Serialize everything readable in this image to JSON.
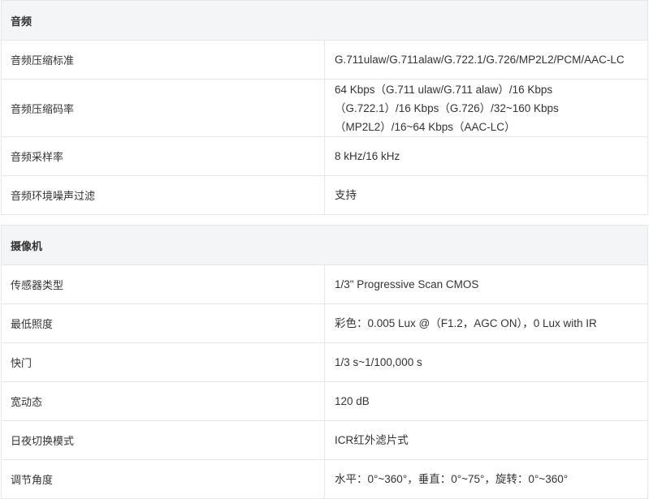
{
  "audio": {
    "title": "音频",
    "rows": [
      {
        "label": "音频压缩标准",
        "value": "G.711ulaw/G.711alaw/G.722.1/G.726/MP2L2/PCM/AAC-LC"
      },
      {
        "label": "音频压缩码率",
        "value": "64 Kbps（G.711 ulaw/G.711 alaw）/16 Kbps（G.722.1）/16 Kbps（G.726）/32~160 Kbps（MP2L2）/16~64 Kbps（AAC-LC）"
      },
      {
        "label": "音频采样率",
        "value": "8 kHz/16 kHz"
      },
      {
        "label": "音频环境噪声过滤",
        "value": "支持"
      }
    ]
  },
  "camera": {
    "title": "摄像机",
    "rows": [
      {
        "label": "传感器类型",
        "value": "1/3\" Progressive Scan CMOS"
      },
      {
        "label": "最低照度",
        "value": "彩色：0.005 Lux @（F1.2，AGC ON），0 Lux with IR"
      },
      {
        "label": "快门",
        "value": "1/3 s~1/100,000 s"
      },
      {
        "label": "宽动态",
        "value": "120 dB"
      },
      {
        "label": "日夜切换模式",
        "value": "ICR红外滤片式"
      },
      {
        "label": "调节角度",
        "value": "水平：0°~360°，垂直：0°~75°，旋转：0°~360°"
      }
    ]
  }
}
